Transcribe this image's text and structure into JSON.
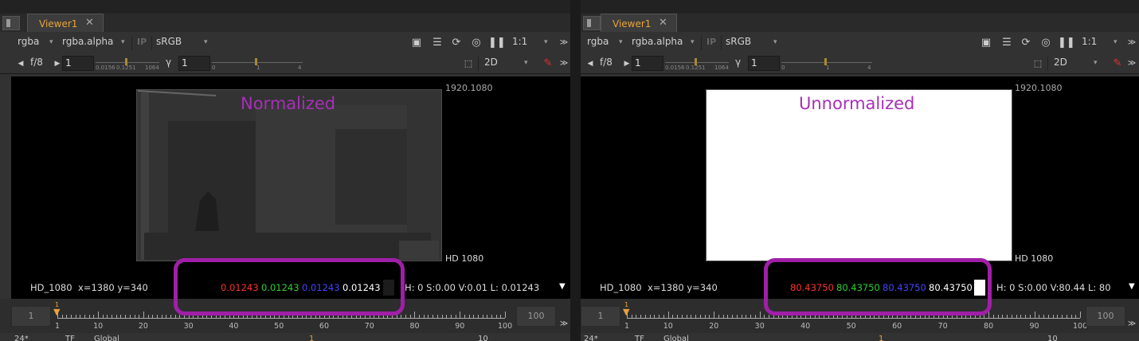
{
  "colors": {
    "red": "#ff3030",
    "green": "#2fd12f",
    "blue": "#3f3fff",
    "accent": "#e9a33a",
    "annotation": "#a01fa8"
  },
  "left": {
    "tab": {
      "title": "Viewer1",
      "close": "✕"
    },
    "toolbar": {
      "channels": "rgba",
      "channel_select": "rgba.alpha",
      "ip": "IP",
      "lut": "sRGB",
      "zoom": "1:1",
      "collapse": "≫"
    },
    "exposure": {
      "fstop": "f/8",
      "gain": "1",
      "gain_ticks": [
        "0.0156",
        "0.1251",
        "1064"
      ],
      "gamma_label": "γ",
      "gamma": "1",
      "gamma_ticks": [
        "0",
        "1",
        "4"
      ],
      "view_mode": "2D"
    },
    "viewer": {
      "format_top": "1920.1080",
      "format_bottom": "HD 1080",
      "annotation": "Normalized",
      "gain_pos": 0.5,
      "gamma_pos": 0.5
    },
    "info": {
      "format": "HD_1080",
      "coords": "x=1380 y=340",
      "r": "0.01243",
      "g": "0.01243",
      "b": "0.01243",
      "a": "0.01243",
      "hsvl": "H:  0 S:0.00 V:0.01  L: 0.01243"
    },
    "timeline": {
      "start": "1",
      "end": "100",
      "current": "1",
      "ticks": [
        "1",
        "10",
        "20",
        "30",
        "40",
        "50",
        "60",
        "70",
        "80",
        "90",
        "100"
      ]
    },
    "playback": {
      "fps": "24*",
      "mode": "TF",
      "range": "Global",
      "frame_marker": "1",
      "step": "10"
    }
  },
  "right": {
    "tab": {
      "title": "Viewer1",
      "close": "✕"
    },
    "toolbar": {
      "channels": "rgba",
      "channel_select": "rgba.alpha",
      "ip": "IP",
      "lut": "sRGB",
      "zoom": "1:1",
      "collapse": "≫"
    },
    "exposure": {
      "fstop": "f/8",
      "gain": "1",
      "gain_ticks": [
        "0.0156",
        "0.1251",
        "1064"
      ],
      "gamma_label": "γ",
      "gamma": "1",
      "gamma_ticks": [
        "0",
        "1",
        "4"
      ],
      "view_mode": "2D"
    },
    "viewer": {
      "format_top": "1920.1080",
      "format_bottom": "HD 1080",
      "annotation": "Unnormalized"
    },
    "info": {
      "format": "HD_1080",
      "coords": "x=1380 y=340",
      "r": "80.43750",
      "g": "80.43750",
      "b": "80.43750",
      "a": "80.43750",
      "hsvl": "H:  0 S:0.00 V:80.44  L: 80"
    },
    "timeline": {
      "start": "1",
      "end": "100",
      "current": "1",
      "ticks": [
        "1",
        "10",
        "20",
        "30",
        "40",
        "50",
        "60",
        "70",
        "80",
        "90",
        "100"
      ]
    },
    "playback": {
      "fps": "24*",
      "mode": "TF",
      "range": "Global",
      "frame_marker": "1",
      "step": "10"
    }
  }
}
